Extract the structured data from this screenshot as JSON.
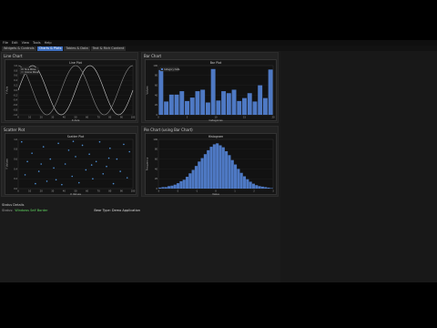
{
  "menu": [
    "File",
    "Edit",
    "View",
    "Tools",
    "Help"
  ],
  "tabs": [
    "Widgets & Controls",
    "Charts & Plots",
    "Tables & Data",
    "Text & Rich Content"
  ],
  "active_tab": 1,
  "panels": {
    "line": {
      "title": "Line Chart"
    },
    "bar": {
      "title": "Bar Chart"
    },
    "scatter": {
      "title": "Scatter Plot"
    },
    "hist": {
      "title": "Pie Chart (using Bar Chart)"
    }
  },
  "status": {
    "header": "Status Details",
    "status_label": "Status:",
    "status_value": "Windows Self Border",
    "right_text": "Bear Type: Demo Application"
  },
  "colors": {
    "accent": "#3e6fbf",
    "bar": "#4e79c4",
    "sine": "#c9c9c9",
    "cosine": "#8a8a8a",
    "point": "#4e8fd4"
  },
  "chart_data": [
    {
      "type": "line",
      "title": "Line Plot",
      "xlabel": "X Axis",
      "ylabel": "Y Axis",
      "series": [
        {
          "name": "Sine Wave",
          "function": "sin"
        },
        {
          "name": "Cosine Wave",
          "function": "cos"
        }
      ],
      "x_ticks": [
        "0",
        "10",
        "20",
        "30",
        "40",
        "50",
        "60",
        "70",
        "80",
        "90",
        "100"
      ],
      "y_ticks": [
        "1.0",
        "0.8",
        "0.6",
        "0.4",
        "0.2",
        "0.0",
        "-0.2",
        "-0.4",
        "-0.6",
        "-0.8",
        "-1.0"
      ],
      "ylim": [
        -1,
        1
      ],
      "legend": "top-left"
    },
    {
      "type": "bar",
      "title": "Bar Plot",
      "xlabel": "Categories",
      "ylabel": "Values",
      "legend_label": "Category Data",
      "values": [
        91,
        27,
        41,
        41,
        48,
        28,
        35,
        48,
        51,
        25,
        93,
        29,
        48,
        44,
        51,
        28,
        34,
        44,
        27,
        60,
        34,
        92
      ],
      "x_ticks": [
        "0",
        "5",
        "10",
        "15",
        "20"
      ],
      "y_ticks": [
        "100",
        "80",
        "60",
        "40",
        "20",
        "0"
      ],
      "ylim": [
        0,
        100
      ]
    },
    {
      "type": "scatter",
      "title": "Scatter Plot",
      "xlabel": "X Values",
      "ylabel": "Y Values",
      "x_ticks": [
        "0",
        "10",
        "20",
        "30",
        "40",
        "50",
        "60",
        "70",
        "80",
        "90",
        "100"
      ],
      "y_ticks": [
        "1.0",
        "0.8",
        "0.6",
        "0.4",
        "0.2",
        "0.0"
      ],
      "xlim": [
        0,
        100
      ],
      "ylim": [
        0,
        1
      ],
      "points": [
        [
          3,
          0.95
        ],
        [
          8,
          0.55
        ],
        [
          12,
          0.72
        ],
        [
          15,
          0.1
        ],
        [
          18,
          0.35
        ],
        [
          22,
          0.85
        ],
        [
          25,
          0.15
        ],
        [
          28,
          0.6
        ],
        [
          31,
          0.42
        ],
        [
          35,
          0.92
        ],
        [
          38,
          0.08
        ],
        [
          41,
          0.5
        ],
        [
          44,
          0.78
        ],
        [
          47,
          0.25
        ],
        [
          50,
          0.65
        ],
        [
          53,
          0.12
        ],
        [
          56,
          0.88
        ],
        [
          59,
          0.38
        ],
        [
          62,
          0.7
        ],
        [
          65,
          0.2
        ],
        [
          68,
          0.55
        ],
        [
          71,
          0.95
        ],
        [
          74,
          0.3
        ],
        [
          77,
          0.45
        ],
        [
          80,
          0.82
        ],
        [
          83,
          0.1
        ],
        [
          86,
          0.6
        ],
        [
          89,
          0.35
        ],
        [
          92,
          0.9
        ],
        [
          95,
          0.22
        ],
        [
          6,
          0.28
        ],
        [
          20,
          0.5
        ],
        [
          33,
          0.18
        ],
        [
          48,
          0.96
        ],
        [
          64,
          0.48
        ],
        [
          79,
          0.62
        ],
        [
          97,
          0.75
        ]
      ]
    },
    {
      "type": "bar",
      "title": "Histogram",
      "xlabel": "Value",
      "ylabel": "Frequency",
      "values": [
        2,
        3,
        3,
        5,
        6,
        8,
        11,
        15,
        18,
        24,
        31,
        38,
        46,
        55,
        62,
        70,
        78,
        85,
        90,
        92,
        88,
        84,
        76,
        68,
        58,
        49,
        40,
        32,
        25,
        19,
        14,
        10,
        7,
        5,
        4,
        3,
        2,
        1
      ],
      "x_ticks": [
        "-3",
        "-2",
        "-1",
        "0",
        "1",
        "2",
        "3"
      ],
      "y_ticks": [
        "100",
        "80",
        "60",
        "40",
        "20",
        "0"
      ],
      "ylim": [
        0,
        100
      ]
    }
  ]
}
